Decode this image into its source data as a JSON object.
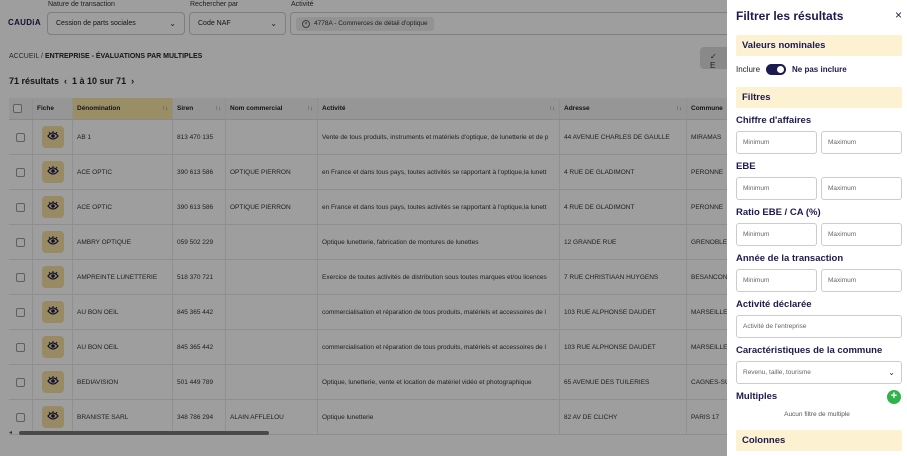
{
  "app": {
    "logo": "CAUDiA"
  },
  "filters_top": {
    "transaction": {
      "label": "Nature de transaction",
      "value": "Cession de parts sociales"
    },
    "search_by": {
      "label": "Rechercher par",
      "value": "Code NAF"
    },
    "activity": {
      "label": "Activité",
      "chip": "4778A - Commerces de détail d'optique"
    }
  },
  "breadcrumb": {
    "home": "ACCUEIL",
    "sep": " / ",
    "current": "ENTREPRISE - ÉVALUATIONS PAR MULTIPLES"
  },
  "top_button": {
    "label": "✓ E"
  },
  "results": {
    "count": "71 résultats",
    "prev": "‹",
    "range": "1 à 10 sur 71",
    "next": "›"
  },
  "table": {
    "headers": {
      "fiche": "Fiche",
      "denomination": "Dénomination",
      "siren": "Siren",
      "nom": "Nom commercial",
      "activite": "Activité",
      "adresse": "Adresse",
      "commune": "Commune"
    },
    "rows": [
      {
        "den": "AB 1",
        "siren": "813 470 135",
        "nom": "",
        "act": "Vente de tous produits, instruments et matériels d'optique, de lunetterie et de p",
        "adr": "44 AVENUE CHARLES DE GAULLE",
        "com": "MIRAMAS"
      },
      {
        "den": "ACE OPTIC",
        "siren": "390 613 586",
        "nom": "OPTIQUE PIERRON",
        "act": "en France et dans tous pays, toutes activités se rapportant à l'optique,la lunett",
        "adr": "4 RUE DE GLADIMONT",
        "com": "PERONNE"
      },
      {
        "den": "ACE OPTIC",
        "siren": "390 613 586",
        "nom": "OPTIQUE PIERRON",
        "act": "en France et dans tous pays, toutes activités se rapportant à l'optique,la lunett",
        "adr": "4 RUE DE GLADIMONT",
        "com": "PERONNE"
      },
      {
        "den": "AMBRY OPTIQUE",
        "siren": "059 502 229",
        "nom": "",
        "act": "Optique lunetterie, fabrication de montures de lunettes",
        "adr": "12 GRANDE RUE",
        "com": "GRENOBLE"
      },
      {
        "den": "AMPREINTE LUNETTERIE",
        "siren": "518 370 721",
        "nom": "",
        "act": "Exercice de toutes activités de distribution sous toutes marques et/ou licences",
        "adr": "7 RUE CHRISTIAAN HUYGENS",
        "com": "BESANCON"
      },
      {
        "den": "AU BON OEIL",
        "siren": "845 365 442",
        "nom": "",
        "act": "commercialisation et réparation de tous produits, matériels et accessoires de l",
        "adr": "103 RUE ALPHONSE DAUDET",
        "com": "MARSEILLE"
      },
      {
        "den": "AU BON OEIL",
        "siren": "845 365 442",
        "nom": "",
        "act": "commercialisation et réparation de tous produits, matériels et accessoires de l",
        "adr": "103 RUE ALPHONSE DAUDET",
        "com": "MARSEILLE"
      },
      {
        "den": "BEDIAVISION",
        "siren": "501 449 789",
        "nom": "",
        "act": "Optique, lunetterie, vente et location de matériel vidéo et photographique",
        "adr": "65 AVENUE DES TUILERIES",
        "com": "CAGNES-SUR"
      },
      {
        "den": "BRANISTE SARL",
        "siren": "348 786 294",
        "nom": "ALAIN AFFLELOU",
        "act": "Optique lunetterie",
        "adr": "82 AV DE CLICHY",
        "com": "PARIS 17"
      }
    ]
  },
  "panel": {
    "title": "Filtrer les résultats",
    "close": "×",
    "nominal": "Valeurs nominales",
    "include": "Inclure",
    "not_include": "Ne pas inclure",
    "filtres": "Filtres",
    "ca": "Chiffre d'affaires",
    "ebe": "EBE",
    "ratio": "Ratio EBE / CA (%)",
    "annee": "Année de la transaction",
    "min": "Minimum",
    "max": "Maximum",
    "activite_declaree": "Activité déclarée",
    "activite_placeholder": "Activité de l'entreprise",
    "carac": "Caractéristiques de la commune",
    "carac_value": "Revenu, taille, tourisme",
    "multiples": "Multiples",
    "no_multiple": "Aucun filtre de multiple",
    "colonnes": "Colonnes"
  }
}
